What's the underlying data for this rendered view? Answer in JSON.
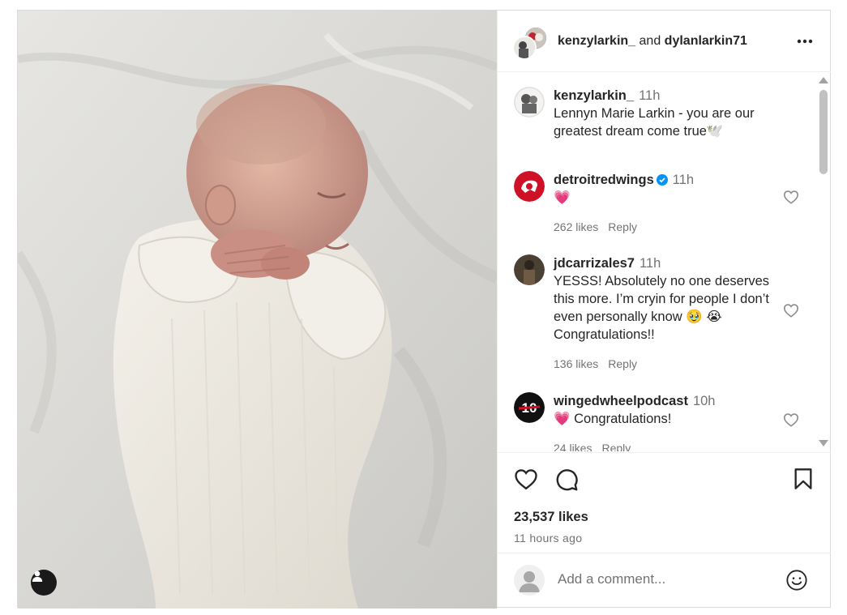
{
  "header": {
    "user1": "kenzylarkin_",
    "joiner": "and",
    "user2": "dylanlarkin71",
    "more_icon": "more-horizontal-icon"
  },
  "comments": [
    {
      "username": "kenzylarkin_",
      "time": "11h",
      "text": "Lennyn Marie Larkin - you are our greatest dream come true🕊️"
    },
    {
      "username": "detroitredwings",
      "verified": true,
      "time": "11h",
      "text": "💗",
      "likes": "262 likes",
      "reply": "Reply"
    },
    {
      "username": "jdcarrizales7",
      "time": "11h",
      "text": "YESSS! Absolutely no one deserves this more. I’m cryin for people I don’t even personally know 🥹 😭 Congratulations!!",
      "likes": "136 likes",
      "reply": "Reply"
    },
    {
      "username": "wingedwheelpodcast",
      "time": "10h",
      "text": "💗 Congratulations!",
      "likes": "24 likes",
      "reply": "Reply"
    }
  ],
  "post": {
    "likes": "23,537 likes",
    "time_ago": "11 hours ago"
  },
  "add_comment": {
    "placeholder": "Add a comment..."
  },
  "colors": {
    "text": "#262626",
    "muted": "#737373",
    "verified": "#0095f6",
    "heart": "#e8467c",
    "redwings": "#ce1126"
  }
}
